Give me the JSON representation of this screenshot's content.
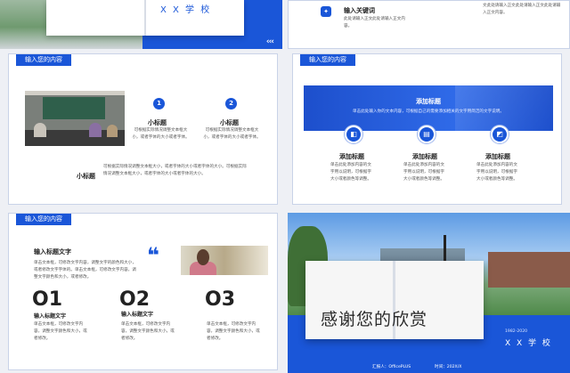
{
  "slide1": {
    "school": "X X 学 校",
    "arrows": "‹‹‹"
  },
  "slide2": {
    "keyword_title": "输入关键词",
    "keyword_desc": "此处请输入正文此处请输入正文内容。",
    "top_text": "文此处请输入正文此处请输入正文此处请输入正文内容。"
  },
  "slide3": {
    "tag": "输入您的内容",
    "items": [
      {
        "num": "1",
        "title": "小标题",
        "desc": "可根据实际情况调整文本框大小，或者字体的大小或者字体。"
      },
      {
        "num": "2",
        "title": "小标题",
        "desc": "可根据实际情况调整文本框大小，或者字体的大小或者字体。"
      }
    ],
    "bottom_title": "小标题",
    "bottom_desc": "可根据实际情况调整文本框大小，或者字体的大小或者字体的大小。可根据实际情况调整文本框大小，或者字体的大小或者字体的大小。"
  },
  "slide4": {
    "tag": "输入您的内容",
    "banner_title": "添加标题",
    "banner_desc": "单击此处输入你的文本内容，可根据自己的需要添加相关的文字用简洁的文字说明。",
    "items": [
      {
        "icon": "◧",
        "icon_name": "image-icon",
        "title": "添加标题",
        "desc": "单击此处添加内容的文字用以说明，可根据字大小或者颜色等调整。"
      },
      {
        "icon": "▤",
        "icon_name": "document-icon",
        "title": "添加标题",
        "desc": "单击此处添加内容的文字用以说明，可根据字大小或者颜色等调整。"
      },
      {
        "icon": "◩",
        "icon_name": "picture-icon",
        "title": "添加标题",
        "desc": "单击此处添加内容的文字用以说明，可根据字大小或者颜色等调整。"
      }
    ]
  },
  "slide5": {
    "tag": "输入您的内容",
    "heading": "输入标题文字",
    "heading_desc": "单击文本框，可修改文字内容，调整文字的颜色和大小，或者修改文字字体的。单击文本框，可修改文字内容，调整文字颜色和大小，或者修改。",
    "quote": "❝",
    "items": [
      {
        "num": "O1",
        "title": "输入标题文字",
        "desc": "单击文本框，可修改文字内容，调整文字颜色和大小，或者修改。"
      },
      {
        "num": "O2",
        "title": "输入标题文字",
        "desc": "单击文本框，可修改文字内容，调整文字颜色和大小，或者修改。"
      },
      {
        "num": "O3",
        "title": "",
        "desc": "单击文本框，可修改文字内容，调整文字颜色和大小，或者修改。"
      }
    ]
  },
  "slide6": {
    "thanks": "感谢您的欣赏",
    "years": "1982-2020",
    "school": "X X 学 校",
    "reporter": "汇报人：OfficePLUS",
    "date": "时间：202X/X"
  }
}
